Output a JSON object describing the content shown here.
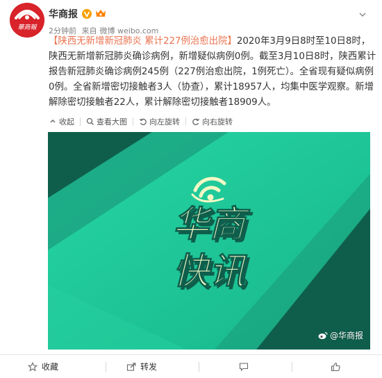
{
  "account": {
    "name": "华商报",
    "verified_icon": "verified-v-icon",
    "member_icon": "weibo-member-icon",
    "avatar_text": "華商報"
  },
  "meta": {
    "time": "2分钟前",
    "source_prefix": "来自",
    "source": "微博 weibo.com"
  },
  "post": {
    "topic": "【陕西无新增新冠肺炎 累计227例治愈出院】",
    "body": "2020年3月9日8时至10日8时，陕西无新增新冠肺炎确诊病例，新增疑似病例0例。截至3月10日8时，陕西累计报告新冠肺炎确诊病例245例（227例治愈出院，1例死亡）。全省现有疑似病例0例。全省新增密切接触者3人（协查），累计18957人，均集中医学观察。新增解除密切接触者22人，累计解除密切接触者18909人。"
  },
  "image_toolbar": {
    "collapse": "收起",
    "view_large": "查看大图",
    "rotate_left": "向左旋转",
    "rotate_right": "向右旋转"
  },
  "image": {
    "line1": "华商",
    "line2": "快讯",
    "watermark": "@华商报",
    "bg_color": "#1fc99a",
    "dark_color": "#0f5e4c",
    "text_color": "#f3f8c4"
  },
  "actions": {
    "favorite": "收藏",
    "forward": "转发",
    "comment": "",
    "like": ""
  }
}
